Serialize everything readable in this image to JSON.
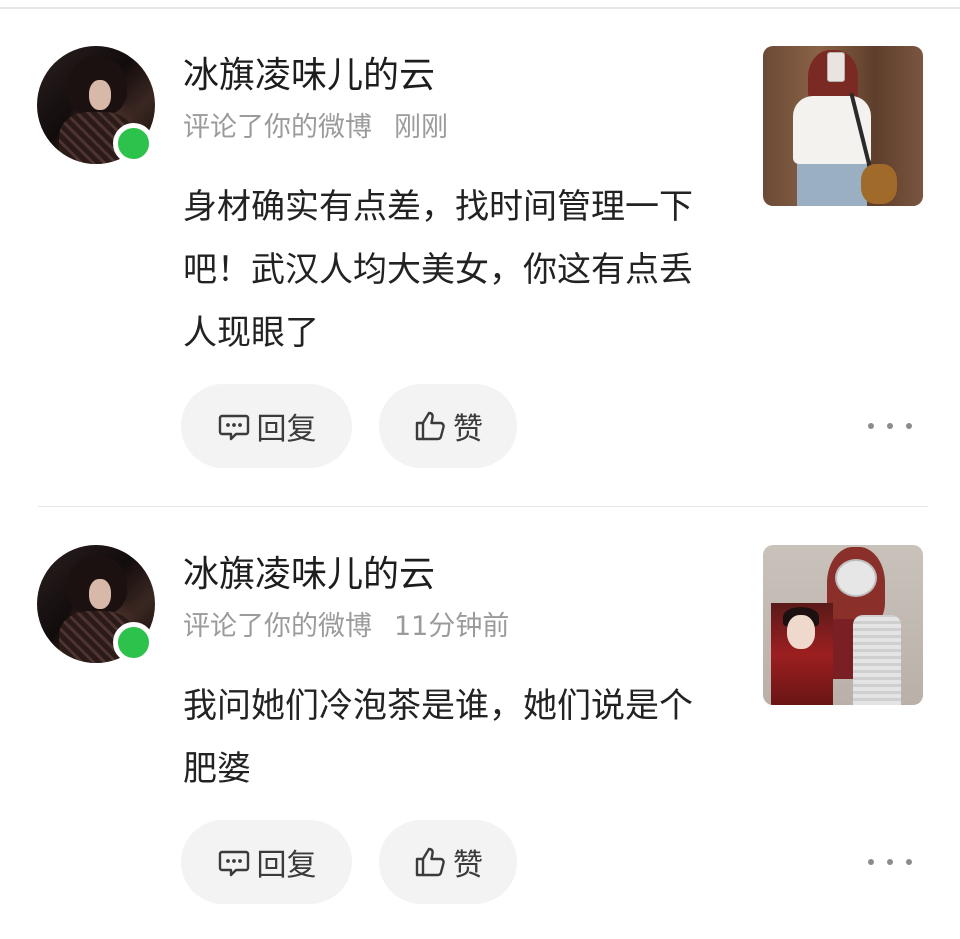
{
  "comments": [
    {
      "username": "冰旗凌味儿的云",
      "action_text": "评论了你的微博",
      "time": "刚刚",
      "content": "身材确实有点差，找时间管理一下吧！武汉人均大美女，你这有点丢人现眼了",
      "reply_label": "回复",
      "like_label": "赞",
      "online": true
    },
    {
      "username": "冰旗凌味儿的云",
      "action_text": "评论了你的微博",
      "time": "11分钟前",
      "content": "我问她们冷泡茶是谁，她们说是个肥婆",
      "reply_label": "回复",
      "like_label": "赞",
      "online": true
    }
  ],
  "icons": {
    "reply": "comment-icon",
    "like": "thumbs-up-icon",
    "more": "more-dots-icon"
  },
  "colors": {
    "online": "#2dc24b",
    "button_bg": "#f3f3f3",
    "meta_text": "#9b9b9b"
  }
}
